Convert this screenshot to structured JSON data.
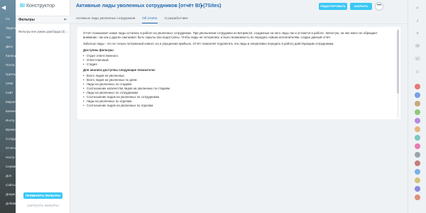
{
  "portal_left": {
    "items": [
      "Се",
      "Задачи",
      "Чат",
      "Диск",
      "Календ",
      "Почта",
      "Группы",
      "CRM",
      "Сайт",
      "Маркет",
      "Бизнес",
      "Инстр",
      "Время",
      "Сотруд",
      "Отчёты",
      "Настр",
      "Сервисы",
      "Доп",
      "Сайты",
      "Докум",
      "Добавить"
    ]
  },
  "app": {
    "title": "BI",
    "subtitle": "Конструктор"
  },
  "filter": {
    "label": "Фильтры",
    "item": "Фильтры вне рамок дашборда (3)",
    "apply_label": "ПРИМЕНИТЬ ФИЛЬТРЫ",
    "reset_label": "СБРОСИТЬ ФИЛЬТРЫ"
  },
  "header": {
    "title": "Активные лиды уволенных сотрудников [отчёт BI] (7Sites)",
    "edit_label": "РЕДАКТИРОВАТЬ",
    "close_label": "ЗАКРЫТЬ",
    "more_label": "•••"
  },
  "tabs": [
    {
      "label": "Активные лиды уволенных сотрудников"
    },
    {
      "label": "Об отчёте"
    },
    {
      "label": "О разработчике"
    }
  ],
  "about": {
    "intro": "Отчёт показывает какие лиды остались в работе на уволенных сотрудниках. При увольнении сотрудника из Битрикс24, созданные на него лиды так и остаются в работе. Зачастую, на них никто не обращает внимание, так как у других сим может быть скрыты или недоступны. Чтобы лиды не потерялись и было возможность их передать новым исполнителям, создан данный отчёт.",
    "summary": "Забытые лиды - это не только потерянный клиент, но и упущенная прибыль. Отчёт позволяет подсветить эти лиды и оперативно передать в работу действующим сотрудникам.",
    "filters_heading": "Доступны фильтры:",
    "filters": [
      "Отдел ответственного",
      "Ответственный",
      "Стадия"
    ],
    "metrics_heading": "Для анализа доступны следующие показатели:",
    "metrics": [
      "Всего лидов на уволенных",
      "Всего лидов на уволенных по дням",
      "Лиды на уволенных по стадиям",
      "Соотношение количества лидов на уволенных по стадиям",
      "Лиды на уволенных по сотрудникам",
      "Соотношение лидов на уволенных по сотрудникам",
      "Лиды на уволенных по отделам",
      "Соотношение лидов на уволенных по отделам"
    ]
  },
  "portal_right": {
    "icons": [
      "search-icon",
      "bell-icon",
      "plus-icon",
      "chat-icon",
      "phone-icon",
      "users-icon"
    ],
    "avatar_colors": [
      "#e87a7a",
      "#7a9fe8",
      "#c9a97a",
      "#8fc77a",
      "#b98ae0",
      "#e8b47a",
      "#7ac7c0",
      "#e87ab4",
      "#9aa3ad",
      "#c77a7a",
      "#7ab0e8",
      "#d4c37a",
      "#8a8ae0",
      "#e0907a"
    ]
  }
}
